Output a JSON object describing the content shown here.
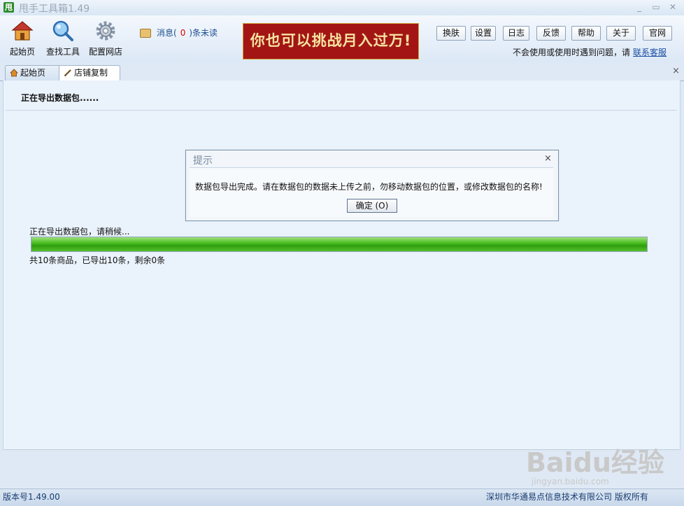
{
  "window": {
    "title": "甩手工具箱1.49",
    "app_icon_char": "甩",
    "min": "_",
    "max": "▭",
    "close": "✕"
  },
  "toolbar": {
    "tools": [
      {
        "label": "起始页",
        "icon": "home-icon"
      },
      {
        "label": "查找工具",
        "icon": "magnifier-icon"
      },
      {
        "label": "配置网店",
        "icon": "gear-icon"
      }
    ],
    "messages": {
      "prefix": "消息(",
      "count": "0",
      "suffix": ")条未读"
    },
    "banner": "你也可以挑战月入过万!",
    "buttons": [
      "换肤",
      "设置",
      "日志",
      "反馈",
      "帮助",
      "关于",
      "官网"
    ],
    "help_text": "不会使用或使用时遇到问题，请",
    "contact_link": "联系客服"
  },
  "tabs": [
    {
      "label": "起始页",
      "icon": "home-icon"
    },
    {
      "label": "店铺复制",
      "icon": "edit-icon",
      "active": true
    }
  ],
  "tabs_close": "×",
  "content": {
    "heading": "正在导出数据包......",
    "waiting": "正在导出数据包，请稍候...",
    "progress_fraction": 1.0,
    "summary": "共10条商品，已导出10条，剩余0条"
  },
  "dialog": {
    "title": "提示",
    "close": "×",
    "message": "数据包导出完成。请在数据包的数据未上传之前，勿移动数据包的位置，或修改数据包的名称!",
    "ok_label": "确定 (O)"
  },
  "statusbar": {
    "version": "版本号1.49.00",
    "copyright": "深圳市华通易点信息技术有限公司 版权所有"
  },
  "watermark": {
    "text": "Baidu经验",
    "url": "jingyan.baidu.com"
  },
  "colors": {
    "accent": "#1a4fa3",
    "banner_bg": "#a31515",
    "progress": "#3fae17",
    "unread": "#dd0000"
  }
}
